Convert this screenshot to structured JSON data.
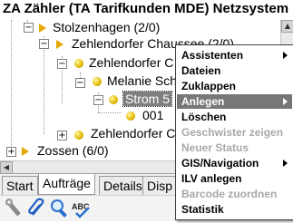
{
  "window": {
    "title": "ZA Zähler (TA Tarifkunden MDE) Netzsystem"
  },
  "tree": {
    "nodes": [
      {
        "label": "Stolzenhagen (2/0)",
        "expander": "−"
      },
      {
        "label": "Zehlendorfer Chaussee (2/0)",
        "expander": "−"
      },
      {
        "label": "Zehlendorfer C",
        "expander": "−"
      },
      {
        "label": "Melanie Sch",
        "expander": "−"
      },
      {
        "label": "Strom 5",
        "expander": "−"
      },
      {
        "label": "001"
      },
      {
        "label": "Zehlendorfer C",
        "expander": "+"
      },
      {
        "label": "Zossen (6/0)",
        "expander": "+"
      }
    ]
  },
  "tabs": [
    "Start",
    "Aufträge",
    "Details",
    "Disp"
  ],
  "context_menu": {
    "items": [
      {
        "label": "Assistenten",
        "submenu": true,
        "enabled": true
      },
      {
        "label": "Dateien",
        "enabled": true
      },
      {
        "label": "Zuklappen",
        "enabled": true
      },
      {
        "label": "Anlegen",
        "submenu": true,
        "enabled": true,
        "highlighted": true
      },
      {
        "label": "Löschen",
        "enabled": true
      },
      {
        "label": "Geschwister zeigen",
        "enabled": false
      },
      {
        "label": "Neuer Status",
        "enabled": false
      },
      {
        "label": "GIS/Navigation",
        "submenu": true,
        "enabled": true
      },
      {
        "label": "ILV anlegen",
        "enabled": true
      },
      {
        "label": "Barcode zuordnen",
        "enabled": false
      },
      {
        "label": "Statistik",
        "enabled": true
      }
    ]
  },
  "toolbar": {
    "icons": [
      "wrench-icon",
      "paperclip-icon",
      "magnifier-icon",
      "spellcheck-abc-icon"
    ],
    "spellcheck_text": "ABC"
  },
  "colors": {
    "menu_highlight": "#777777",
    "tree_icon_yellow": "#e5a800"
  }
}
